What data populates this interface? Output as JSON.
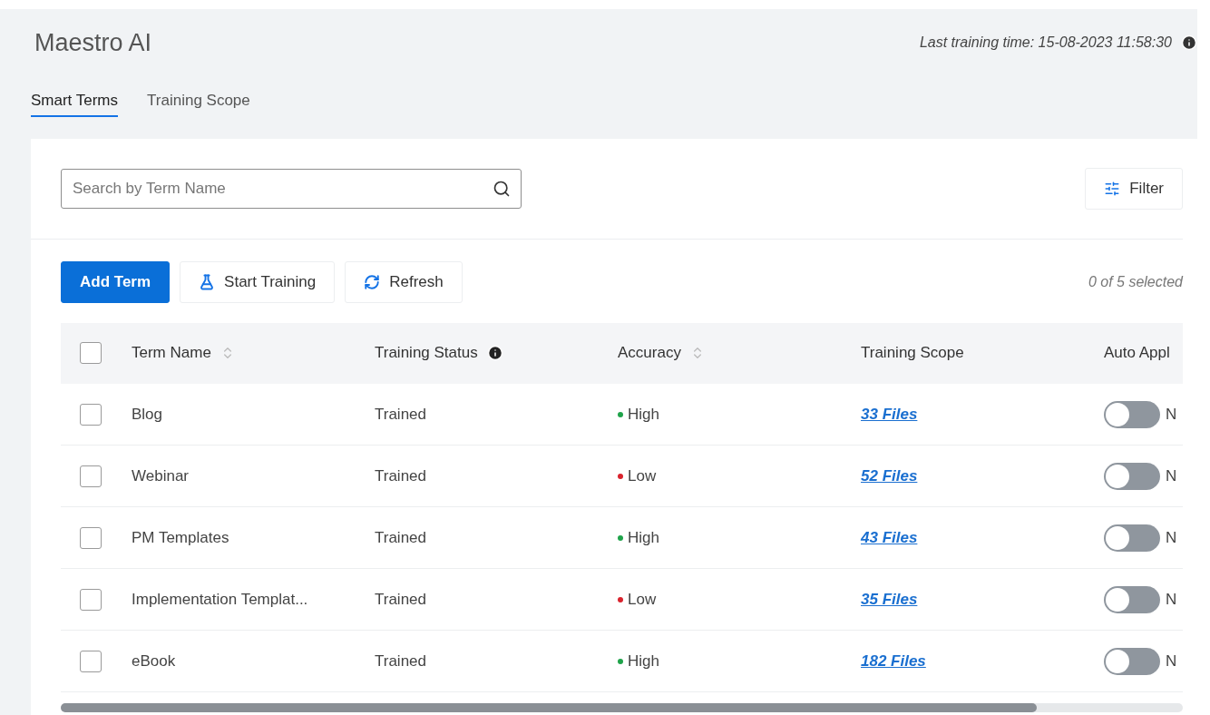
{
  "header": {
    "title": "Maestro AI",
    "last_training": "Last training time: 15-08-2023 11:58:30"
  },
  "tabs": [
    {
      "label": "Smart Terms",
      "selected": true
    },
    {
      "label": "Training Scope",
      "selected": false
    }
  ],
  "search": {
    "placeholder": "Search by Term Name"
  },
  "filter_button": "Filter",
  "actions": [
    {
      "label": "Add Term",
      "kind": "primary"
    },
    {
      "label": "Start Training",
      "kind": "flask"
    },
    {
      "label": "Refresh",
      "kind": "refresh"
    }
  ],
  "selection_count": "0 of 5 selected",
  "table": {
    "columns": [
      {
        "label": "Term Name",
        "kind": "sortable"
      },
      {
        "label": "Training Status",
        "kind": "info"
      },
      {
        "label": "Accuracy",
        "kind": "sortable"
      },
      {
        "label": "Training Scope",
        "kind": "plain"
      },
      {
        "label": "Auto Appl",
        "kind": "plain"
      }
    ],
    "header_checked": false,
    "rows": [
      {
        "checked": false,
        "term": "Blog",
        "status": "Trained",
        "accuracy": "High",
        "color": "#1fa34a",
        "scope": "33 Files",
        "auto_apply": false,
        "auto_label": "N"
      },
      {
        "checked": false,
        "term": "Webinar",
        "status": "Trained",
        "accuracy": "Low",
        "color": "#d9232d",
        "scope": "52 Files",
        "auto_apply": false,
        "auto_label": "N"
      },
      {
        "checked": false,
        "term": "PM Templates",
        "status": "Trained",
        "accuracy": "High",
        "color": "#1fa34a",
        "scope": "43 Files",
        "auto_apply": false,
        "auto_label": "N"
      },
      {
        "checked": false,
        "term": "Implementation Templat...",
        "status": "Trained",
        "accuracy": "Low",
        "color": "#d9232d",
        "scope": "35 Files",
        "auto_apply": false,
        "auto_label": "N"
      },
      {
        "checked": false,
        "term": "eBook",
        "status": "Trained",
        "accuracy": "High",
        "color": "#1fa34a",
        "scope": "182 Files",
        "auto_apply": false,
        "auto_label": "N"
      }
    ]
  }
}
